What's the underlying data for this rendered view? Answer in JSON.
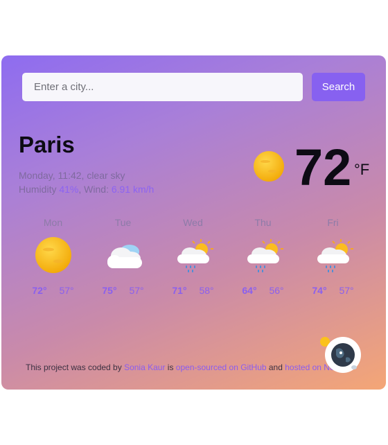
{
  "search": {
    "placeholder": "Enter a city...",
    "button_label": "Search"
  },
  "current": {
    "city": "Paris",
    "datetime_desc": "Monday, 11:42, clear sky",
    "humidity_label": "Humidity",
    "humidity_value": "41%",
    "wind_label": "Wind:",
    "wind_value": "6.91 km/h",
    "temperature": "72",
    "unit": "°F",
    "icon": "sun-icon"
  },
  "forecast": [
    {
      "day": "Mon",
      "max": "72°",
      "min": "57°",
      "icon": "sun-icon"
    },
    {
      "day": "Tue",
      "max": "75°",
      "min": "57°",
      "icon": "cloud-icon"
    },
    {
      "day": "Wed",
      "max": "71°",
      "min": "58°",
      "icon": "rain-sun-icon"
    },
    {
      "day": "Thu",
      "max": "64°",
      "min": "56°",
      "icon": "rain-sun-icon"
    },
    {
      "day": "Fri",
      "max": "74°",
      "min": "57°",
      "icon": "rain-sun-icon"
    }
  ],
  "footer": {
    "text1": "This project was coded by ",
    "author": "Sonia Kaur",
    "text2": " is ",
    "github": "open-sourced on GitHub",
    "text3": " and ",
    "netlify": "hosted on Netlify"
  },
  "colors": {
    "accent": "#8761f0",
    "gradient_start": "#8e6cf0",
    "gradient_end": "#f4a676"
  }
}
